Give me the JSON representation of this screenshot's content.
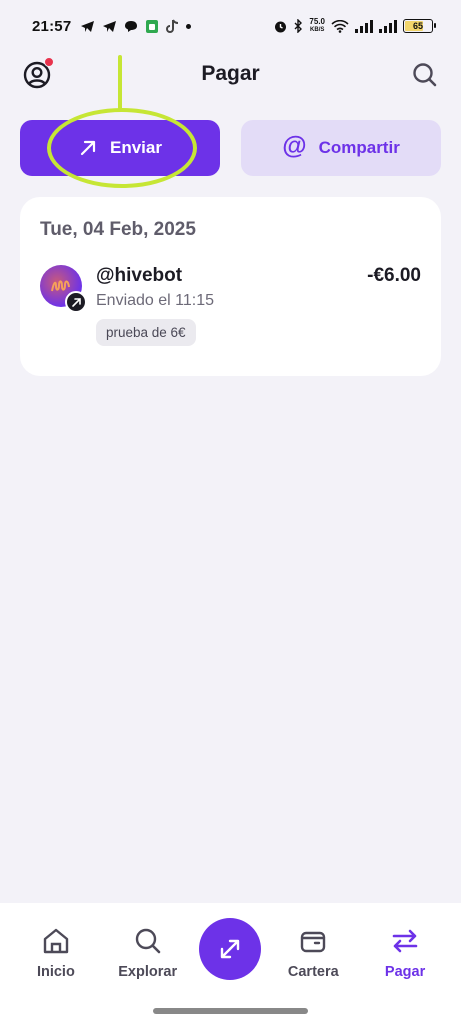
{
  "status_bar": {
    "time": "21:57",
    "network_speed_value": "75.0",
    "network_speed_unit": "KB/S",
    "battery": "65"
  },
  "header": {
    "title": "Pagar"
  },
  "actions": {
    "send_label": "Enviar",
    "share_label": "Compartir",
    "share_symbol": "@"
  },
  "transactions": {
    "date": "Tue, 04 Feb, 2025",
    "items": [
      {
        "user": "@hivebot",
        "subtitle": "Enviado el 11:15",
        "note": "prueba de 6€",
        "amount": "-€6.00"
      }
    ]
  },
  "nav": {
    "items": [
      {
        "label": "Inicio",
        "icon": "home-icon"
      },
      {
        "label": "Explorar",
        "icon": "search-icon"
      },
      {
        "label": "",
        "icon": "transfer-icon"
      },
      {
        "label": "Cartera",
        "icon": "wallet-icon"
      },
      {
        "label": "Pagar",
        "icon": "exchange-arrows-icon",
        "active": true
      }
    ]
  },
  "colors": {
    "accent": "#6d32e8",
    "accent_light": "#e3dcf7",
    "highlight": "#c6e635",
    "background": "#f3f2f8"
  }
}
